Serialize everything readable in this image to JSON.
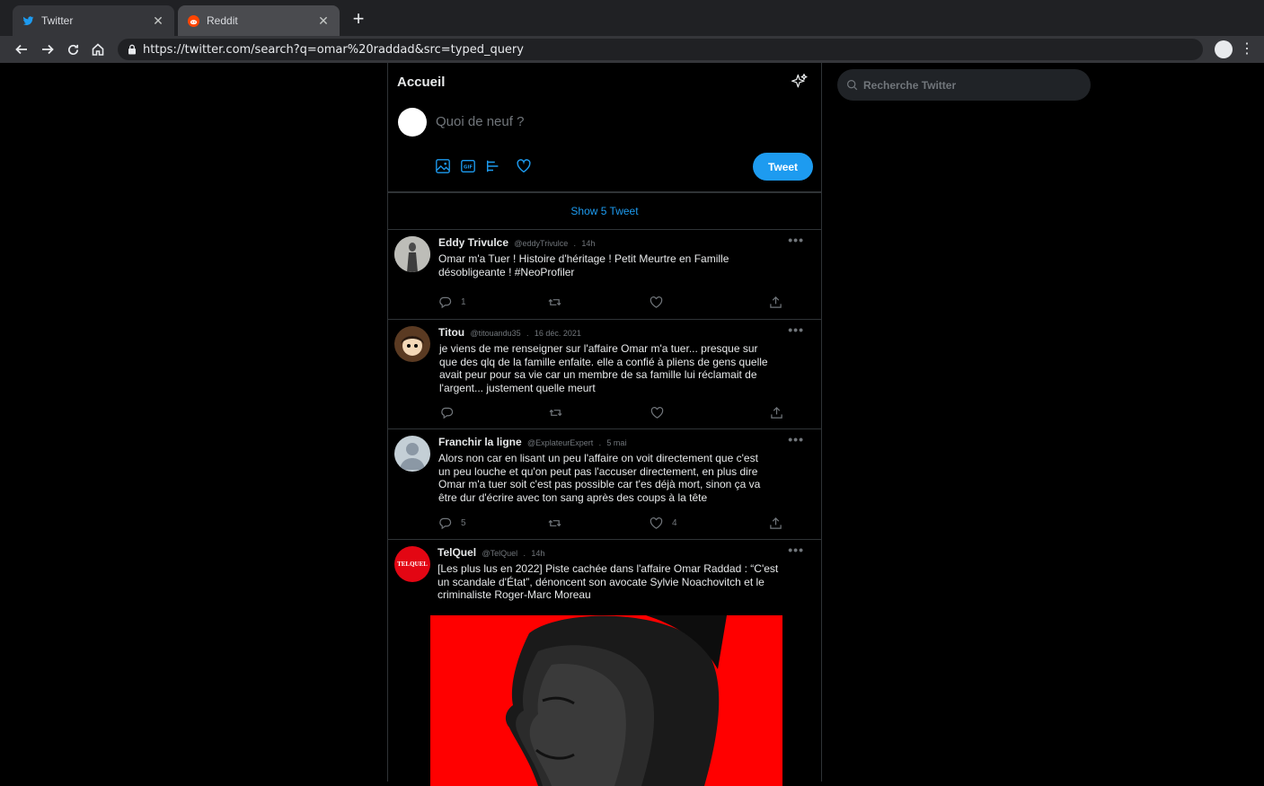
{
  "browser": {
    "tabs": [
      {
        "label": "Twitter",
        "icon": "twitter-bird-icon",
        "active": true
      },
      {
        "label": "Reddit",
        "icon": "reddit-icon",
        "active": false
      }
    ],
    "url": "https://twitter.com/search?q=omar%20raddad&src=typed_query"
  },
  "header": {
    "title": "Accueil"
  },
  "search": {
    "placeholder": "Recherche Twitter"
  },
  "compose": {
    "placeholder": "Quoi de neuf ?",
    "tweet_label": "Tweet"
  },
  "show_more": "Show 5 Tweet",
  "tweets": [
    {
      "name": "Eddy Trivulce",
      "handle": "@eddyTrivulce",
      "time": "14h",
      "text": "Omar m'a Tuer ! Histoire d'héritage ! Petit Meurtre en Famille désobligeante ! #NeoProfiler",
      "replies": "1",
      "retweets": "",
      "likes": ""
    },
    {
      "name": "Titou",
      "handle": "@titouandu35",
      "time": "16 déc. 2021",
      "text": "je viens de me renseigner sur l'affaire Omar m'a tuer... presque sur que des qlq de la famille enfaite. elle a confié à pliens de gens quelle avait peur pour sa vie car un membre de sa famille lui réclamait de l'argent... justement quelle meurt",
      "replies": "",
      "retweets": "",
      "likes": ""
    },
    {
      "name": "Franchir la ligne",
      "handle": "@ExplateurExpert",
      "time": "5 mai",
      "text": "Alors non car en lisant un peu l'affaire on voit directement que c'est un peu louche et qu'on peut pas l'accuser directement, en plus dire Omar m'a tuer soit c'est pas possible car t'es déjà mort, sinon ça va être dur d'écrire avec ton sang après des coups à la tête",
      "replies": "5",
      "retweets": "",
      "likes": "4"
    },
    {
      "name": "TelQuel",
      "handle": "@TelQuel",
      "time": "14h",
      "avatar_text": "TELQUEL",
      "text": "[Les plus lus en 2022] Piste cachée dans l'affaire Omar Raddad : “C'est un scandale d'État”, dénoncent son avocate Sylvie Noachovitch et le criminaliste Roger-Marc Moreau"
    }
  ]
}
